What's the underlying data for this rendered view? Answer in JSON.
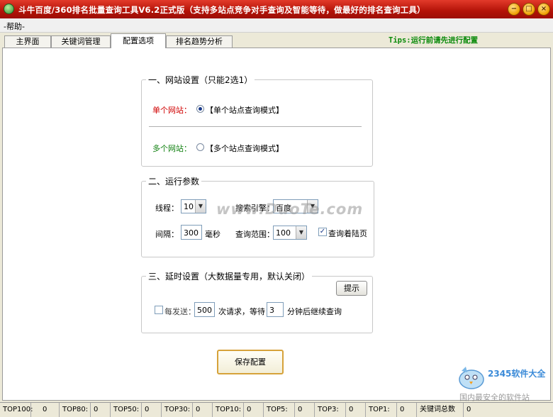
{
  "window": {
    "title": "斗牛百度/360排名批量查询工具V6.2正式版（支持多站点竞争对手查询及智能等待，做最好的排名查询工具）",
    "min_glyph": "−",
    "max_glyph": "□",
    "close_glyph": "×"
  },
  "menu": {
    "help": "-帮助-"
  },
  "tabs": [
    {
      "label": "主界面"
    },
    {
      "label": "关键词管理"
    },
    {
      "label": "配置选项"
    },
    {
      "label": "排名趋势分析"
    }
  ],
  "tips": "Tips:运行前请先进行配置",
  "website_settings": {
    "legend": "一、网站设置（只能2选1）",
    "single_label": "单个网站：",
    "single_option": "【单个站点查询模式】",
    "multi_label": "多个网站：",
    "multi_option": "【多个站点查询模式】"
  },
  "run_params": {
    "legend": "二、运行参数",
    "threads_label": "线程：",
    "threads_value": "10",
    "engine_label": "搜索引擎：",
    "engine_value": "百度",
    "interval_label": "间隔：",
    "interval_value": "300",
    "interval_unit": "毫秒",
    "range_label": "查询范围：",
    "range_value": "100",
    "query_landing_label": "查询着陆页",
    "check_mark": "✓"
  },
  "delay_settings": {
    "legend": "三、延时设置（大数据量专用，默认关闭）",
    "hint_button": "提示",
    "every_send_label": "每发送：",
    "request_count": "500",
    "times_wait_label": "次请求，等待：",
    "wait_minutes": "3",
    "resume_label": "分钟后继续查询"
  },
  "save_button": "保存配置",
  "watermark": "www.DuoTe.com",
  "brand": {
    "name": "2345软件大全",
    "sub": "国内最安全的软件站"
  },
  "status": [
    {
      "label": "TOP100:",
      "value": "0"
    },
    {
      "label": "TOP80:",
      "value": "0"
    },
    {
      "label": "TOP50:",
      "value": "0"
    },
    {
      "label": "TOP30:",
      "value": "0"
    },
    {
      "label": "TOP10:",
      "value": "0"
    },
    {
      "label": "TOP5:",
      "value": "0"
    },
    {
      "label": "TOP3:",
      "value": "0"
    },
    {
      "label": "TOP1:",
      "value": "0"
    },
    {
      "label": "关键词总数",
      "value": "0"
    }
  ],
  "colors": {
    "titlebar": "#c41a0e",
    "single_label": "#d00000",
    "multi_label": "#108010",
    "tips": "#0a8a0a",
    "save_border": "#d6a23a"
  }
}
